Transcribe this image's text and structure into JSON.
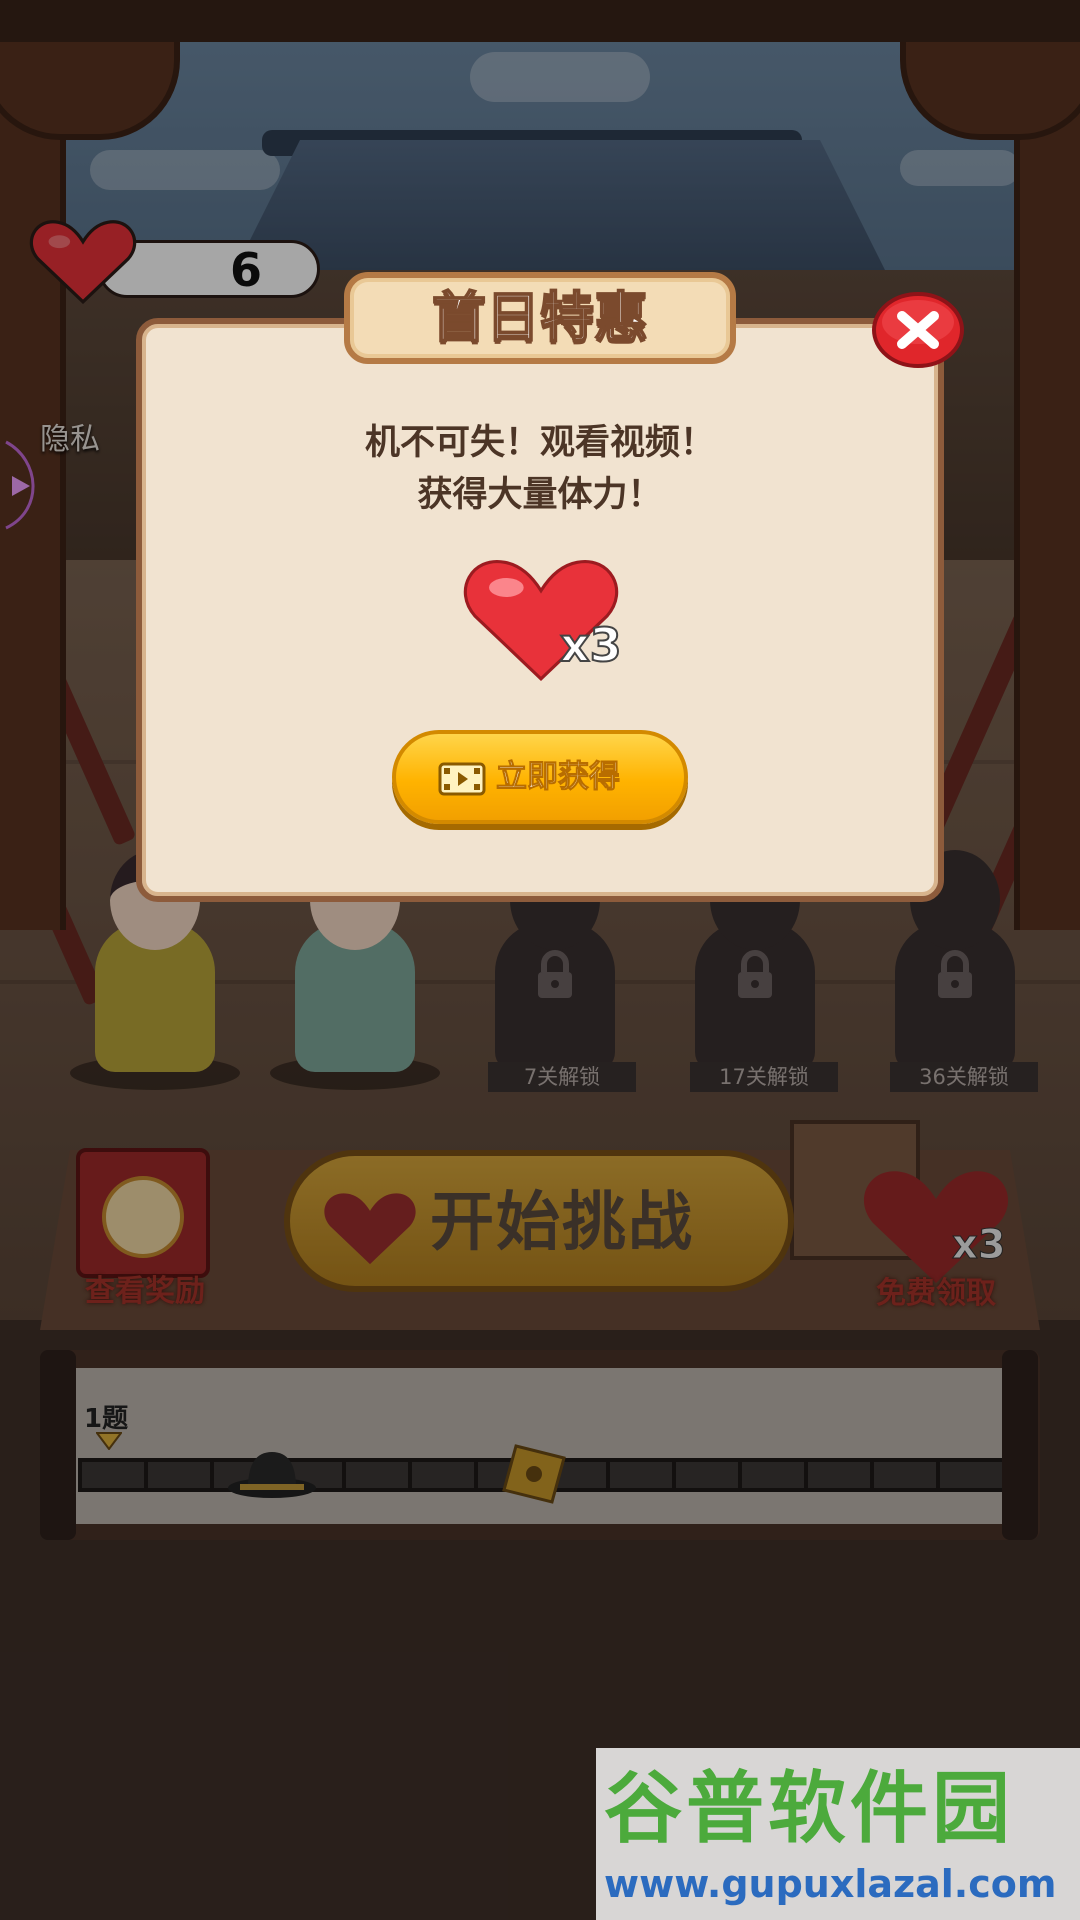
{
  "hud": {
    "lives_count": "6",
    "privacy_label": "隐私",
    "colors": {
      "heart": "#e8323a"
    }
  },
  "characters": [
    {
      "state": "unlocked",
      "palette": "yellow-pink"
    },
    {
      "state": "unlocked",
      "palette": "teal"
    },
    {
      "state": "locked",
      "unlock_text": "7关解锁",
      "icon": "lock-icon"
    },
    {
      "state": "locked",
      "unlock_text": "17关解锁",
      "icon": "lock-icon"
    },
    {
      "state": "locked",
      "unlock_text": "36关解锁",
      "icon": "lock-icon"
    }
  ],
  "controls": {
    "view_rewards_label": "查看奖励",
    "start_label": "开始挑战",
    "free_claim_label": "免费领取",
    "free_claim_multiplier": "x3"
  },
  "progress": {
    "current_level_label": "1题",
    "icons": [
      "hat-icon",
      "token-icon"
    ]
  },
  "dialog": {
    "title": "首日特惠",
    "message_line1": "机不可失！观看视频！",
    "message_line2": "获得大量体力！",
    "reward_multiplier": "x3",
    "claim_button_label": "立即获得",
    "close_icon": "close-icon",
    "colors": {
      "panel": "#f1e3d0",
      "button": "#ffb300",
      "close": "#e0262b"
    }
  },
  "watermark": {
    "title": "谷普软件园",
    "url": "www.gupuxlazal.com"
  }
}
